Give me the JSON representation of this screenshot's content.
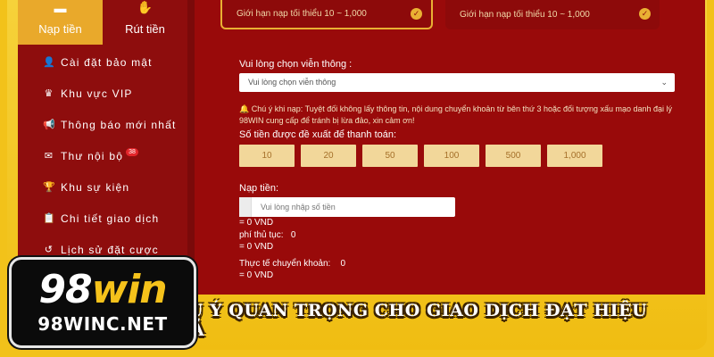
{
  "sidebar": {
    "tabs": [
      {
        "label": "Nạp tiền",
        "icon": "wallet-icon",
        "active": true
      },
      {
        "label": "Rút tiền",
        "icon": "hand-money-icon",
        "active": false
      }
    ],
    "items": [
      {
        "label": "Cài đặt bảo mật",
        "icon": "user-lock-icon"
      },
      {
        "label": "Khu vực VIP",
        "icon": "crown-icon"
      },
      {
        "label": "Thông báo mới nhất",
        "icon": "megaphone-icon"
      },
      {
        "label": "Thư nội bộ",
        "icon": "envelope-icon",
        "badge": "38"
      },
      {
        "label": "Khu sự kiện",
        "icon": "trophy-icon"
      },
      {
        "label": "Chi tiết giao dịch",
        "icon": "clipboard-icon"
      },
      {
        "label": "Lịch sử đặt cược",
        "icon": "history-icon"
      }
    ]
  },
  "limits": {
    "left": "Giới hạn nạp tối thiểu 10 ~ 1,000",
    "right": "Giới hạn nạp tối thiểu 10 ~ 1,000"
  },
  "carrier": {
    "label": "Vui lòng chọn viễn thông :",
    "selected": "Vui lòng chọn viễn thông"
  },
  "note": {
    "line1": "Chú ý khi nạp: Tuyệt đối không lấy thông tin, nội dung chuyển khoản từ bên thứ 3 hoặc đối tượng xấu mạo danh đại lý",
    "line2": "98WIN cung cấp để tránh bị lừa đảo, xin cảm ơn!"
  },
  "suggested": {
    "label": "Số tiền được đề xuất để thanh toán:",
    "amounts": [
      "10",
      "20",
      "50",
      "100",
      "500",
      "1,000"
    ]
  },
  "deposit": {
    "label": "Nạp tiền:",
    "placeholder": "Vui lòng nhập số tiền",
    "converted": "= 0 VND",
    "fee_label": "phí thủ tục:",
    "fee_value": "0",
    "fee_converted": "= 0 VND",
    "actual_label": "Thực tế chuyển khoản:",
    "actual_value": "0",
    "actual_converted": "= 0 VND"
  },
  "banner": {
    "text": "LƯU Ý QUAN TRỌNG CHO GIAO DỊCH ĐẠT HIỆU QUẢ"
  },
  "logo": {
    "main_num": "98",
    "main_word": "win",
    "sub": "98WINC.NET"
  },
  "colors": {
    "accent": "#e9a92b",
    "background": "#990a0a",
    "banner": "#f2c21a"
  }
}
